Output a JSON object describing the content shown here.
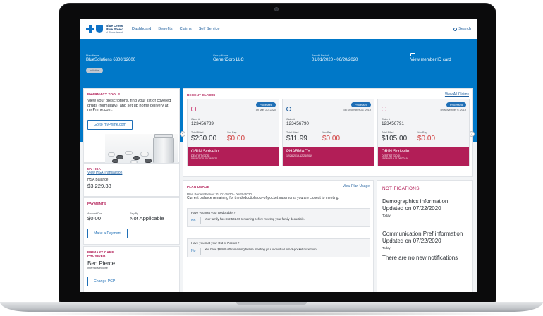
{
  "header": {
    "logo_line1": "Blue Cross",
    "logo_line2": "Blue Shield",
    "logo_line3": "of Rhode Island",
    "nav": [
      "Dashboard",
      "Benefits",
      "Claims",
      "Self Service"
    ],
    "search_label": "Search"
  },
  "banner": {
    "plan_label": "Plan Name",
    "plan_value": "BlueSolutions 6300/12600",
    "status": "In Active",
    "group_label": "Group Name",
    "group_value": "GeneriCorp LLC",
    "period_label": "Benefit Period",
    "period_value": "01/01/2020 - 06/20/2020",
    "id_card_link": "View member ID card"
  },
  "pharmacy": {
    "title": "PHARMACY TOOLS",
    "text": "View your prescriptions, find your list of covered drugs (formulary), and set up home delivery at myPrime.com.",
    "button": "Go to myPrime.com"
  },
  "hsa": {
    "title": "MY HSA",
    "link": "View HSA Transaction",
    "balance_label": "HSA Balance",
    "balance_value": "$3,229.38"
  },
  "payments": {
    "title": "PAYMENTS",
    "amount_label": "Amount Due",
    "amount_value": "$0.00",
    "payby_label": "Pay By",
    "payby_value": "Not Applicable",
    "button": "Make a Payment"
  },
  "pcp": {
    "title": "PRIMARY CARE PROVIDER",
    "name": "Ben Pierce",
    "specialty": "Internal Medicine",
    "button": "Change PCP"
  },
  "claims": {
    "title": "RECENT CLAIMS",
    "view_all": "View All Claims",
    "claim_label": "Claim #",
    "total_label": "Total Billed",
    "pay_label": "You Pay",
    "items": [
      {
        "status": "Processed",
        "date": "on May 20, 2020",
        "number": "123456789",
        "total": "$230.00",
        "pay": "$0.00",
        "provider": "ORIN Scrivello",
        "type": "DENTIST (DDS)",
        "dates": "05/19/2020-05/19/2020",
        "icon": "tooth-icon"
      },
      {
        "status": "Processed",
        "date": "on December 26, 2019",
        "number": "123456790",
        "total": "$11.99",
        "pay": "$0.00",
        "provider": "PHARMACY",
        "type": "",
        "dates": "12/26/2019-12/26/2019",
        "icon": "pill-icon"
      },
      {
        "status": "Processed",
        "date": "on November 6, 2019",
        "number": "123456791",
        "total": "$105.00",
        "pay": "$0.00",
        "provider": "ORIN Scrivello",
        "type": "DENTIST (DDS)",
        "dates": "11/06/2019-11/06/2019",
        "icon": "tooth-icon"
      }
    ]
  },
  "usage": {
    "title": "PLAN USAGE",
    "link": "View Plan Usage",
    "period": "Plan Benefit Period: 01/01/2020 - 06/20/2020",
    "desc": "Current balance remaining for the deductible/out-of-pocket maximums you are closest to meeting.",
    "q1": "Have you met your Deductible ?",
    "a1_no": "No",
    "a1": "Your family has $12,522.96 remaining before meeting your family deductible.",
    "q2": "Have you met your Out of Pocket ?",
    "a2_no": "No",
    "a2": "You have $6,800.00 remaining before meeting your individual out-of-pocket maximum."
  },
  "notifications": {
    "title": "NOTIFICATIONS",
    "items": [
      {
        "heading": "Demographics information Updated on 07/22/2020",
        "sub": "Today"
      },
      {
        "heading": "Communication Pref information Updated on 07/22/2020",
        "sub": "Today"
      }
    ],
    "empty": "There are no new notifications"
  },
  "colors": {
    "brand_blue": "#0078c8",
    "accent_magenta": "#b21e57",
    "button_blue": "#1f6fb6",
    "pay_red": "#d03d3d"
  }
}
